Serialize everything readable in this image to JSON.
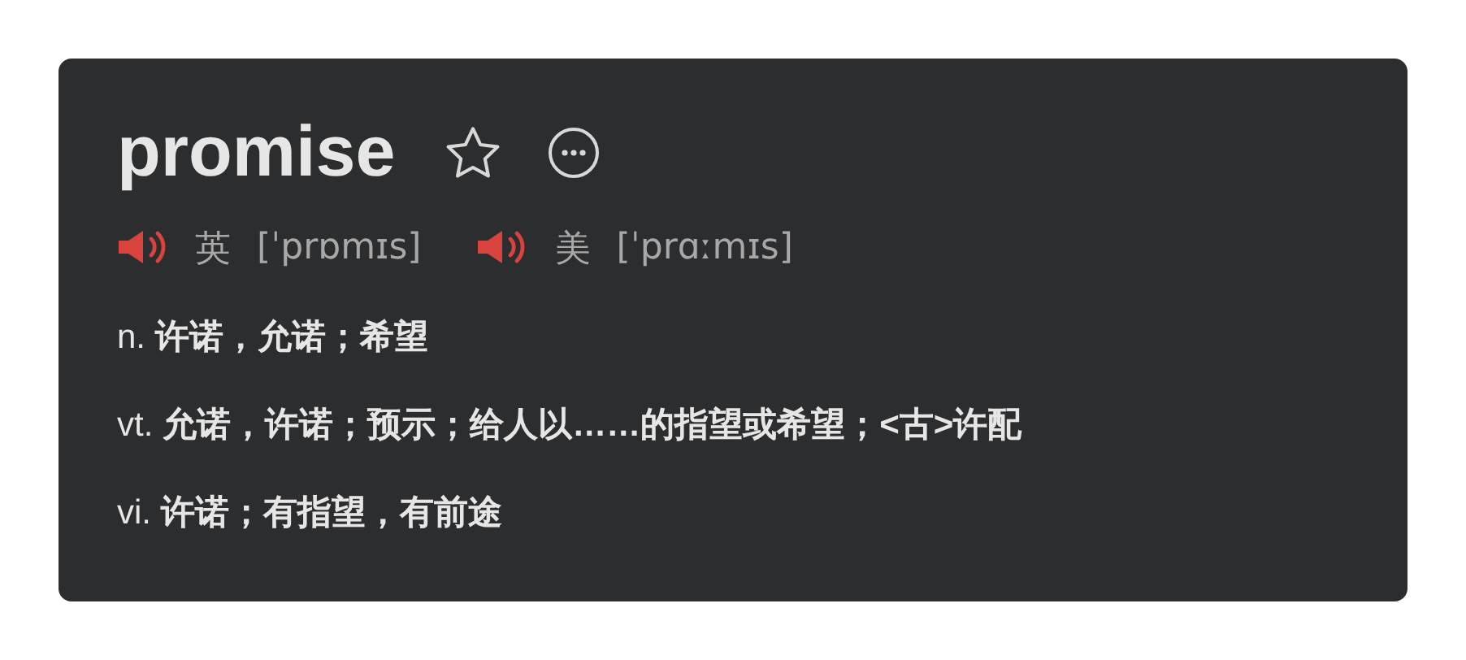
{
  "word": "promise",
  "pronunciations": [
    {
      "label": "英",
      "phonetic": "[ˈprɒmɪs]"
    },
    {
      "label": "美",
      "phonetic": "[ˈprɑːmɪs]"
    }
  ],
  "definitions": [
    {
      "pos": "n.",
      "meaning": "许诺，允诺；希望"
    },
    {
      "pos": "vt.",
      "meaning": "允诺，许诺；预示；给人以……的指望或希望；<古>许配"
    },
    {
      "pos": "vi.",
      "meaning": "许诺；有指望，有前途"
    }
  ]
}
